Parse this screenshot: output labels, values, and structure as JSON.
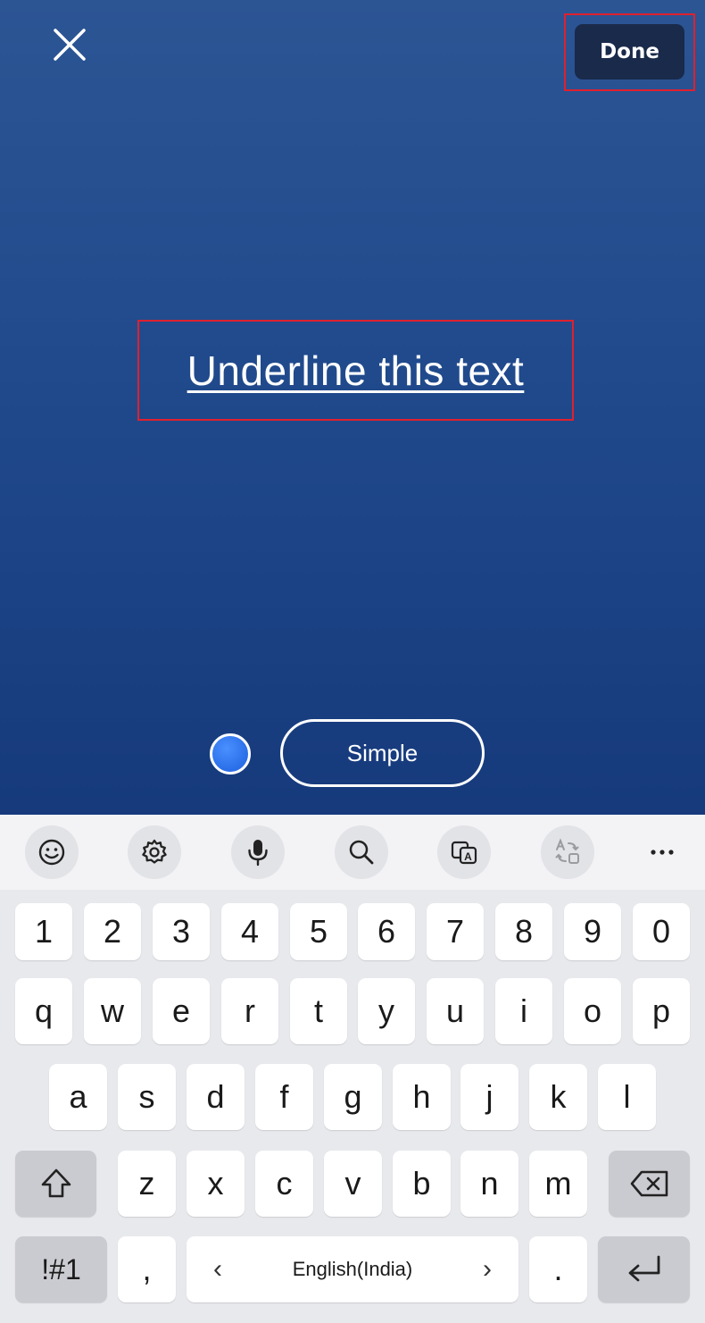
{
  "editor": {
    "done_label": "Done",
    "text": "Underline this text",
    "style_label": "Simple",
    "text_color": "#ffffff",
    "color_dot": "#2a6ee8",
    "close_icon": "close-icon"
  },
  "keyboard": {
    "toolbar": [
      "emoji-icon",
      "gear-icon",
      "microphone-icon",
      "search-icon",
      "translate-icon",
      "text-convert-icon",
      "more-icon"
    ],
    "number_row": [
      "1",
      "2",
      "3",
      "4",
      "5",
      "6",
      "7",
      "8",
      "9",
      "0"
    ],
    "row1": [
      "q",
      "w",
      "e",
      "r",
      "t",
      "y",
      "u",
      "i",
      "o",
      "p"
    ],
    "row2": [
      "a",
      "s",
      "d",
      "f",
      "g",
      "h",
      "j",
      "k",
      "l"
    ],
    "row3": [
      "z",
      "x",
      "c",
      "v",
      "b",
      "n",
      "m"
    ],
    "symbols_label": "!#1",
    "comma": ",",
    "space_label": "English(India)",
    "period": "."
  }
}
